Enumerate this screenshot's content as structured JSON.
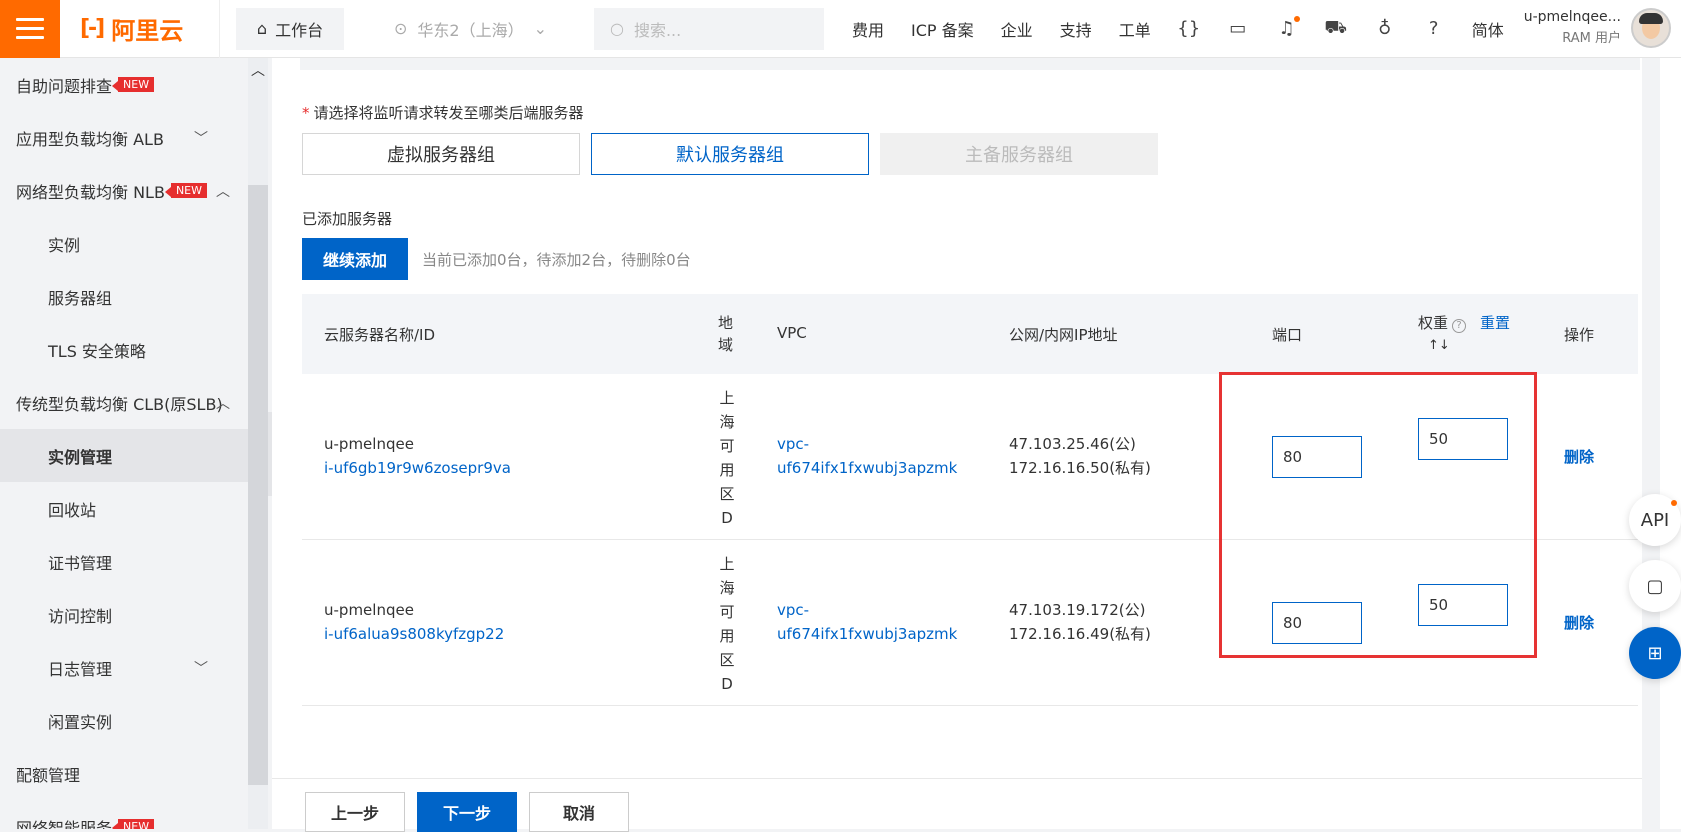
{
  "topbar": {
    "logo_text": "阿里云",
    "workbench": "工作台",
    "region": "华东2（上海）",
    "search_placeholder": "搜索...",
    "nav": [
      "费用",
      "ICP 备案",
      "企业",
      "支持",
      "工单"
    ],
    "lang": "简体",
    "user_name": "u-pmelnqee...",
    "user_role": "RAM 用户",
    "accent_color": "#ff6a00"
  },
  "sidebar": {
    "items": [
      {
        "label": "自助问题排查",
        "badge": "NEW"
      },
      {
        "label": "应用型负载均衡 ALB"
      },
      {
        "label": "网络型负载均衡 NLB",
        "badge": "NEW"
      },
      {
        "label": "实例"
      },
      {
        "label": "服务器组"
      },
      {
        "label": "TLS 安全策略"
      },
      {
        "label": "传统型负载均衡 CLB(原SLB)"
      },
      {
        "label": "实例管理"
      },
      {
        "label": "回收站"
      },
      {
        "label": "证书管理"
      },
      {
        "label": "访问控制"
      },
      {
        "label": "日志管理"
      },
      {
        "label": "闲置实例"
      },
      {
        "label": "配额管理"
      },
      {
        "label": "网络智能服务",
        "badge": "NEW"
      }
    ]
  },
  "form": {
    "prompt": "请选择将监听请求转发至哪类后端服务器",
    "groups": [
      "虚拟服务器组",
      "默认服务器组",
      "主备服务器组"
    ],
    "added_label": "已添加服务器",
    "add_button": "继续添加",
    "hint": "当前已添加0台，待添加2台，待删除0台"
  },
  "table": {
    "headers": {
      "name": "云服务器名称/ID",
      "zone": "地域",
      "vpc": "VPC",
      "ip": "公网/内网IP地址",
      "port": "端口",
      "weight": "权重",
      "reset": "重置",
      "action": "操作"
    },
    "rows": [
      {
        "name": "u-pmelnqee",
        "id": "i-uf6gb19r9w6zosepr9va",
        "zone": [
          "上",
          "海",
          "可",
          "用",
          "区",
          "D"
        ],
        "vpc_a": "vpc-",
        "vpc_b": "uf674ifx1fxwubj3apzmk",
        "ip_public": "47.103.25.46(公)",
        "ip_private": "172.16.16.50(私有)",
        "port": "80",
        "weight": "50",
        "delete": "删除"
      },
      {
        "name": "u-pmelnqee",
        "id": "i-uf6alua9s808kyfzgp22",
        "zone": [
          "上",
          "海",
          "可",
          "用",
          "区",
          "D"
        ],
        "vpc_a": "vpc-",
        "vpc_b": "uf674ifx1fxwubj3apzmk",
        "ip_public": "47.103.19.172(公)",
        "ip_private": "172.16.16.49(私有)",
        "port": "80",
        "weight": "50",
        "delete": "删除"
      }
    ]
  },
  "footer": {
    "prev": "上一步",
    "next": "下一步",
    "cancel": "取消"
  },
  "floating": {
    "api": "API"
  }
}
